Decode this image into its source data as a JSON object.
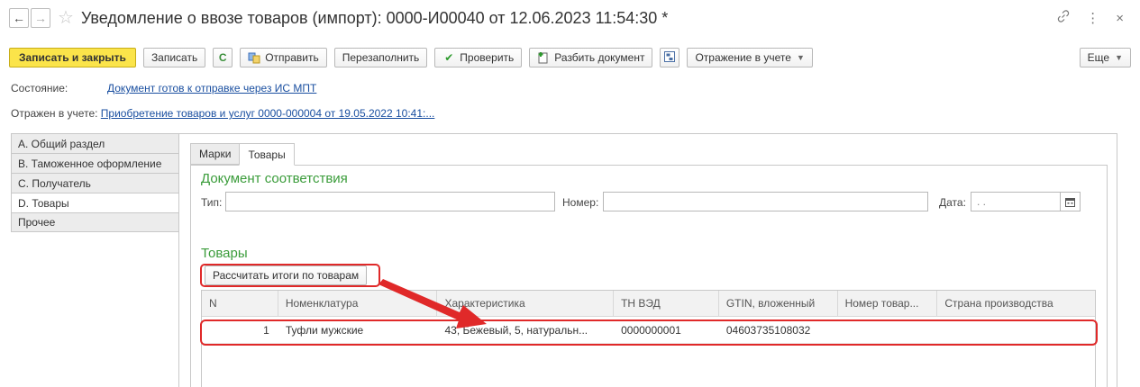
{
  "window": {
    "title": "Уведомление о ввозе товаров (импорт): 0000-И00040 от 12.06.2023 11:54:30 *",
    "back_glyph": "←",
    "forward_glyph": "→",
    "star_glyph": "☆",
    "link_glyph": "🔗",
    "menu_glyph": "⋮",
    "close_glyph": "×"
  },
  "toolbar": {
    "save_close": "Записать и закрыть",
    "save": "Записать",
    "refresh_glyph": "C",
    "send": "Отправить",
    "refill": "Перезаполнить",
    "check": "Проверить",
    "split": "Разбить документ",
    "reflection": "Отражение в учете",
    "more": "Еще"
  },
  "state": {
    "label": "Состояние:",
    "value": "Документ готов к отправке через ИС МПТ"
  },
  "accounting": {
    "label": "Отражен в учете:",
    "value": "Приобретение товаров и услуг 0000-000004 от 19.05.2022 10:41:..."
  },
  "sidenav": {
    "items": [
      {
        "label": "A. Общий раздел",
        "active": false
      },
      {
        "label": "B. Таможенное оформление",
        "active": false
      },
      {
        "label": "C. Получатель",
        "active": false
      },
      {
        "label": "D. Товары",
        "active": true
      },
      {
        "label": "Прочее",
        "active": false
      }
    ]
  },
  "tabs": [
    {
      "label": "Марки",
      "active": false
    },
    {
      "label": "Товары",
      "active": true
    }
  ],
  "compliance": {
    "title": "Документ соответствия",
    "type_label": "Тип:",
    "type_value": "",
    "number_label": "Номер:",
    "number_value": "",
    "date_label": "Дата:",
    "date_value": " .  ."
  },
  "goods": {
    "title": "Товары",
    "calc_button": "Рассчитать итоги по товарам",
    "columns": [
      "N",
      "Номенклатура",
      "Характеристика",
      "ТН ВЭД",
      "GTIN, вложенный",
      "Номер товар...",
      "Страна производства"
    ],
    "rows": [
      {
        "n": "1",
        "nom": "Туфли мужские",
        "char": "43, Бежевый, 5, натуральн...",
        "tn": "0000000001",
        "gtin": "04603735108032",
        "nomer": "",
        "country": ""
      }
    ]
  },
  "colors": {
    "accent_yellow": "#fbe44a",
    "group_green": "#3a9c3a",
    "highlight_red": "#e02929",
    "link_blue": "#1a4fa0"
  }
}
